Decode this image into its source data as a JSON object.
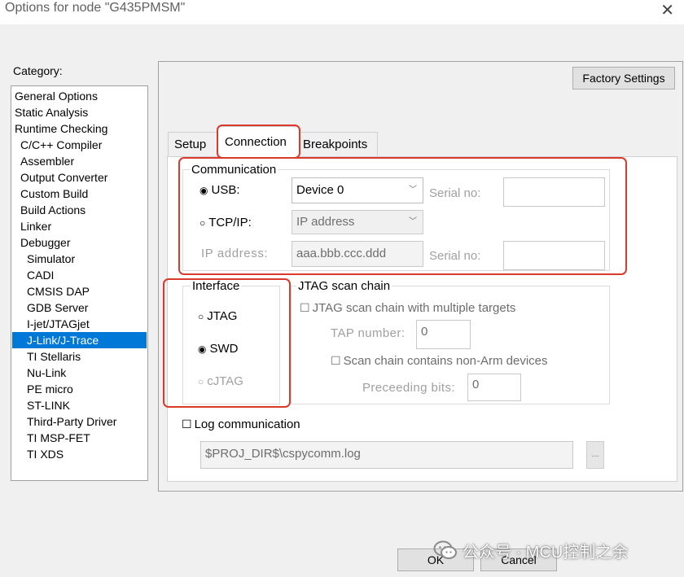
{
  "window": {
    "title": "Options for node \"G435PMSM\"",
    "close_glyph": "✕"
  },
  "category": {
    "label": "Category:",
    "items": [
      {
        "label": "General Options",
        "indent": 0
      },
      {
        "label": "Static Analysis",
        "indent": 0
      },
      {
        "label": "Runtime Checking",
        "indent": 0
      },
      {
        "label": "C/C++ Compiler",
        "indent": 1
      },
      {
        "label": "Assembler",
        "indent": 1
      },
      {
        "label": "Output Converter",
        "indent": 1
      },
      {
        "label": "Custom Build",
        "indent": 1
      },
      {
        "label": "Build Actions",
        "indent": 1
      },
      {
        "label": "Linker",
        "indent": 1
      },
      {
        "label": "Debugger",
        "indent": 1
      },
      {
        "label": "Simulator",
        "indent": 2
      },
      {
        "label": "CADI",
        "indent": 2
      },
      {
        "label": "CMSIS DAP",
        "indent": 2
      },
      {
        "label": "GDB Server",
        "indent": 2
      },
      {
        "label": "I-jet/JTAGjet",
        "indent": 2
      },
      {
        "label": "J-Link/J-Trace",
        "indent": 2,
        "selected": true
      },
      {
        "label": "TI Stellaris",
        "indent": 2
      },
      {
        "label": "Nu-Link",
        "indent": 2
      },
      {
        "label": "PE micro",
        "indent": 2
      },
      {
        "label": "ST-LINK",
        "indent": 2
      },
      {
        "label": "Third-Party Driver",
        "indent": 2
      },
      {
        "label": "TI MSP-FET",
        "indent": 2
      },
      {
        "label": "TI XDS",
        "indent": 2
      }
    ]
  },
  "buttons": {
    "factory_settings": "Factory Settings",
    "ok": "OK",
    "cancel": "Cancel",
    "ellipsis": "..."
  },
  "tabs": [
    {
      "label": "Setup"
    },
    {
      "label": "Connection",
      "active": true
    },
    {
      "label": "Breakpoints"
    }
  ],
  "communication": {
    "title": "Communication",
    "usb_label": "USB:",
    "usb_selected": true,
    "usb_device": "Device 0",
    "serial_label": "Serial no:",
    "tcpip_label": "TCP/IP:",
    "tcpip_selected": false,
    "tcpip_mode": "IP address",
    "ip_label": "IP address:",
    "ip_value": "aaa.bbb.ccc.ddd",
    "serial_label_2": "Serial no:"
  },
  "interface": {
    "title": "Interface",
    "options": [
      {
        "label": "JTAG",
        "selected": false,
        "enabled": true
      },
      {
        "label": "SWD",
        "selected": true,
        "enabled": true
      },
      {
        "label": "cJTAG",
        "selected": false,
        "enabled": false
      }
    ]
  },
  "jtag_scan": {
    "title": "JTAG scan chain",
    "multi_targets_label": "JTAG scan chain with multiple targets",
    "tap_label": "TAP number:",
    "tap_value": "0",
    "non_arm_label": "Scan chain contains non-Arm devices",
    "preceding_label": "Preceeding bits:",
    "preceding_value": "0"
  },
  "log": {
    "label": "Log communication",
    "checked": false,
    "path": "$PROJ_DIR$\\cspycomm.log"
  },
  "watermark": {
    "text": "公众号 · MCU控制之余"
  },
  "colors": {
    "selection": "#0078d7",
    "annotation": "#d93a2b"
  }
}
